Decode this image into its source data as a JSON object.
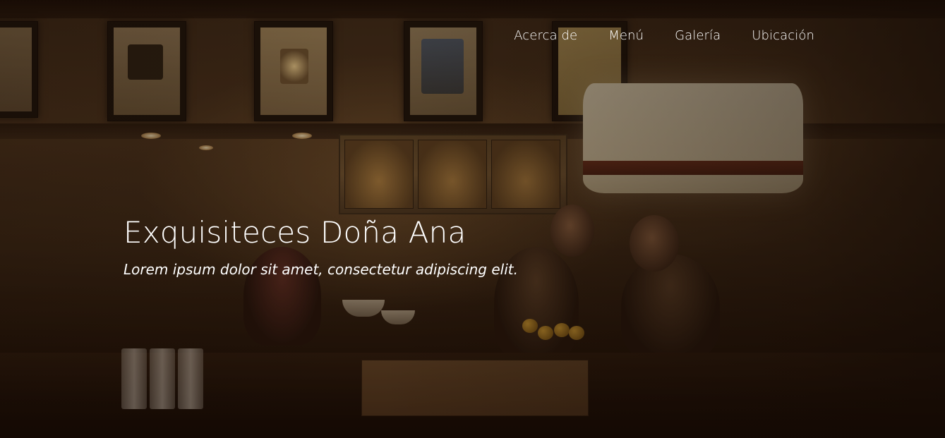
{
  "nav": {
    "items": [
      {
        "label": "Acerca de"
      },
      {
        "label": "Menú"
      },
      {
        "label": "Galería"
      },
      {
        "label": "Ubicación"
      }
    ]
  },
  "hero": {
    "title": "Exquisiteces Doña Ana",
    "subtitle": "Lorem ipsum dolor sit amet, consectetur adipiscing elit.",
    "background_image": "cafe-interior-photo"
  },
  "colors": {
    "text": "#ffffff",
    "overlay": "#1b0f08"
  }
}
